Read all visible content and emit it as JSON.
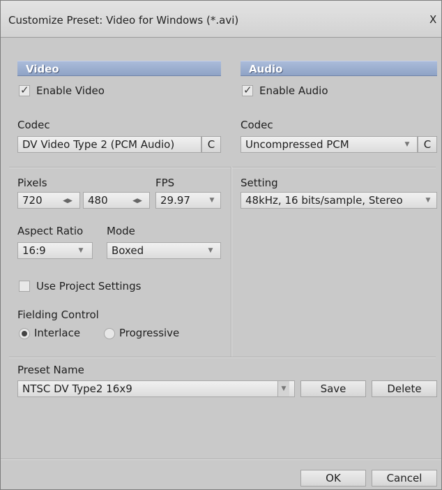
{
  "window": {
    "title": "Customize Preset: Video for Windows (*.avi)",
    "close_label": "X"
  },
  "video": {
    "header": "Video",
    "enable_label": "Enable Video",
    "enabled": true,
    "codec_label": "Codec",
    "codec_value": "DV Video Type 2 (PCM Audio)",
    "codec_config_label": "C",
    "pixels_label": "Pixels",
    "width": "720",
    "height": "480",
    "fps_label": "FPS",
    "fps_value": "29.97",
    "aspect_label": "Aspect Ratio",
    "aspect_value": "16:9",
    "mode_label": "Mode",
    "mode_value": "Boxed",
    "use_project_label": "Use Project Settings",
    "use_project_checked": false,
    "fielding_label": "Fielding Control",
    "interlace_label": "Interlace",
    "progressive_label": "Progressive",
    "fielding_selected": "Interlace"
  },
  "audio": {
    "header": "Audio",
    "enable_label": "Enable Audio",
    "enabled": true,
    "codec_label": "Codec",
    "codec_value": "Uncompressed PCM",
    "codec_config_label": "C",
    "setting_label": "Setting",
    "setting_value": "48kHz, 16 bits/sample, Stereo"
  },
  "preset": {
    "name_label": "Preset Name",
    "name_value": "NTSC DV Type2 16x9",
    "save_label": "Save",
    "delete_label": "Delete"
  },
  "footer": {
    "ok_label": "OK",
    "cancel_label": "Cancel"
  }
}
